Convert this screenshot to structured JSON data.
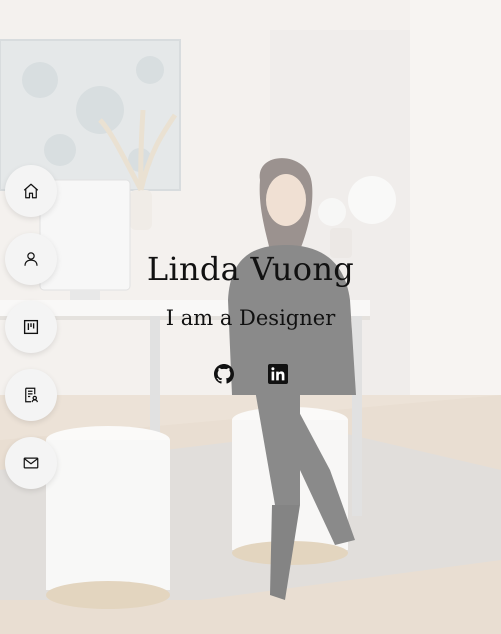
{
  "hero": {
    "name": "Linda Vuong",
    "tagline": "I am a Designer"
  },
  "nav": {
    "items": [
      {
        "id": "home",
        "icon": "home-icon"
      },
      {
        "id": "about",
        "icon": "user-icon"
      },
      {
        "id": "portfolio",
        "icon": "kanban-icon"
      },
      {
        "id": "resume",
        "icon": "resume-icon"
      },
      {
        "id": "contact",
        "icon": "mail-icon"
      }
    ]
  },
  "social": [
    {
      "id": "github",
      "icon": "github-icon"
    },
    {
      "id": "linkedin",
      "icon": "linkedin-icon"
    }
  ],
  "colors": {
    "text": "#111111",
    "nav_bg": "#f4f4f4",
    "overlay": "#ffffff"
  }
}
